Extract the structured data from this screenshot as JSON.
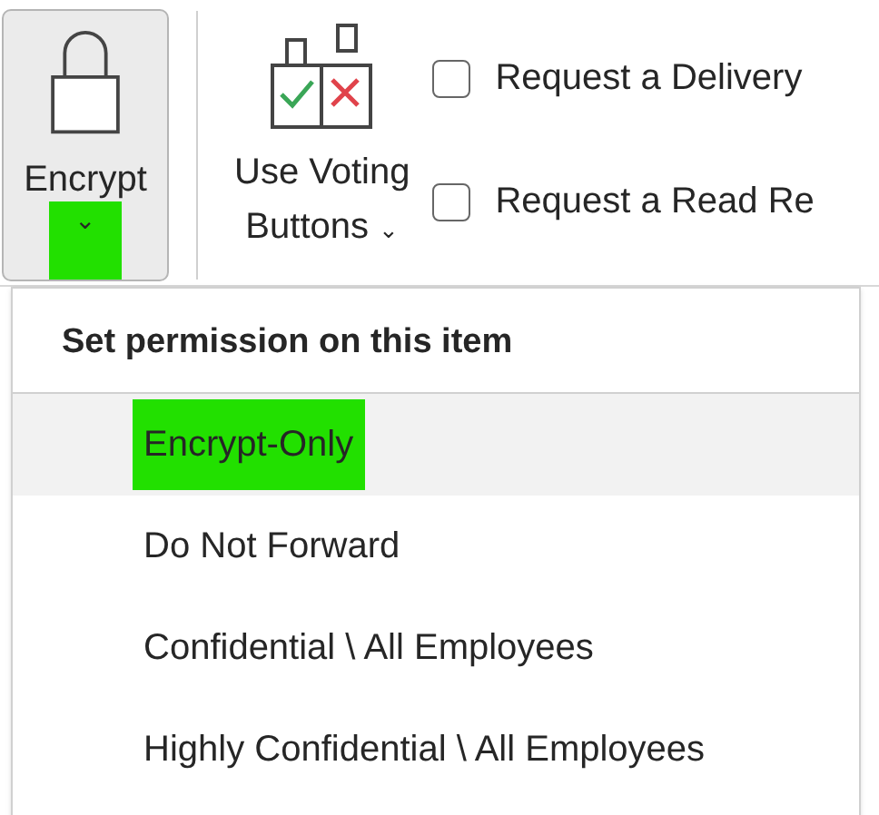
{
  "encrypt_button": {
    "label": "Encrypt",
    "caret": "⌄",
    "caret_highlighted": true
  },
  "voting_button": {
    "label_line_1": "Use Voting",
    "label_line_2": "Buttons",
    "caret": "⌄"
  },
  "checkboxes": [
    {
      "label": "Request a Delivery",
      "checked": false
    },
    {
      "label": "Request a Read Re",
      "checked": false
    }
  ],
  "menu": {
    "header": "Set permission on this item",
    "items": [
      {
        "label": "Encrypt-Only",
        "selected": true,
        "highlighted": true
      },
      {
        "label": "Do Not Forward",
        "selected": false,
        "highlighted": false
      },
      {
        "label": "Confidential \\ All Employees",
        "selected": false,
        "highlighted": false
      },
      {
        "label": "Highly Confidential \\ All Employees",
        "selected": false,
        "highlighted": false
      }
    ]
  }
}
